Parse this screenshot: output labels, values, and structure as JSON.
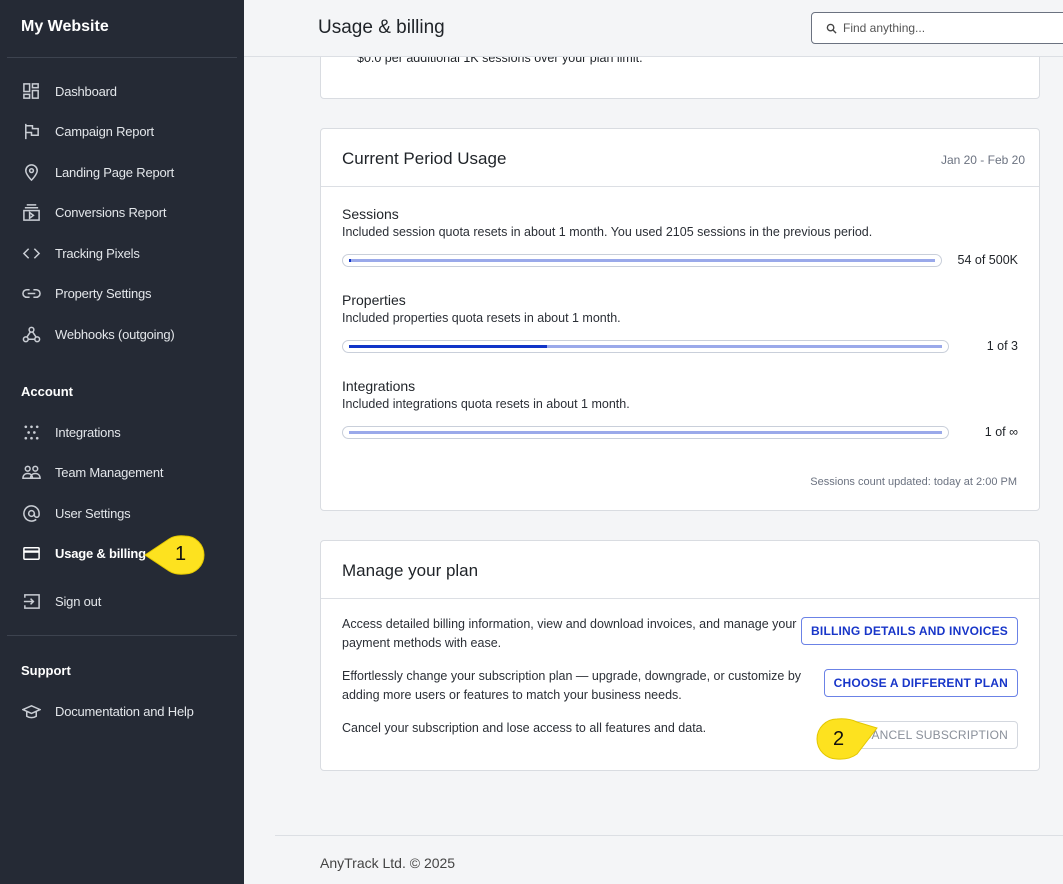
{
  "sidebar": {
    "brand": "My Website",
    "items": [
      {
        "label": "Dashboard",
        "icon": "dashboard-icon"
      },
      {
        "label": "Campaign Report",
        "icon": "flag-icon"
      },
      {
        "label": "Landing Page Report",
        "icon": "location-pin-icon"
      },
      {
        "label": "Conversions Report",
        "icon": "video-stack-icon"
      },
      {
        "label": "Tracking Pixels",
        "icon": "code-icon"
      },
      {
        "label": "Property Settings",
        "icon": "link-icon"
      },
      {
        "label": "Webhooks (outgoing)",
        "icon": "webhook-icon"
      }
    ],
    "account_title": "Account",
    "account_items": [
      {
        "label": "Integrations",
        "icon": "dots-icon"
      },
      {
        "label": "Team Management",
        "icon": "team-icon"
      },
      {
        "label": "User Settings",
        "icon": "at-icon"
      },
      {
        "label": "Usage & billing",
        "icon": "credit-card-icon",
        "active": true
      },
      {
        "label": "Sign out",
        "icon": "sign-out-icon"
      }
    ],
    "support_title": "Support",
    "support_items": [
      {
        "label": "Documentation and Help",
        "icon": "graduation-cap-icon"
      }
    ]
  },
  "header": {
    "title": "Usage & billing",
    "search_placeholder": "Find anything..."
  },
  "top_card": {
    "text": "$0.0 per additional 1K sessions over your plan limit."
  },
  "usage": {
    "title": "Current Period Usage",
    "range": "Jan 20 - Feb 20",
    "metrics": [
      {
        "name": "Sessions",
        "desc": "Included session quota resets in about 1 month. You used 2105 sessions in the previous period.",
        "value": "54 of 500K",
        "used": 54,
        "limit": 500000
      },
      {
        "name": "Properties",
        "desc": "Included properties quota resets in about 1 month.",
        "value": "1 of 3",
        "used": 1,
        "limit": 3
      },
      {
        "name": "Integrations",
        "desc": "Included integrations quota resets in about 1 month.",
        "value": "1 of ∞",
        "used": 1,
        "limit": null
      }
    ],
    "note": "Sessions count updated: today at 2:00 PM"
  },
  "plan": {
    "title": "Manage your plan",
    "rows": [
      {
        "text": "Access detailed billing information, view and download invoices, and manage your payment methods with ease.",
        "button": "BILLING DETAILS AND INVOICES"
      },
      {
        "text": "Effortlessly change your subscription plan — upgrade, downgrade, or customize by adding more users or features to match your business needs.",
        "button": "CHOOSE A DIFFERENT PLAN"
      },
      {
        "text": "Cancel your subscription and lose access to all features and data.",
        "button": "CANCEL SUBSCRIPTION"
      }
    ]
  },
  "footer": {
    "text": "AnyTrack Ltd. © 2025"
  },
  "annotations": [
    "1",
    "2"
  ],
  "colors": {
    "sidebar": "#252a35",
    "accent": "#1034c8",
    "bar_track": "#9aa9ea",
    "callout": "#fde21f"
  }
}
